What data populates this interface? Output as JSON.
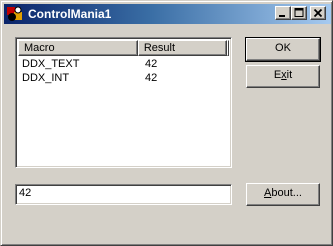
{
  "window": {
    "title": "ControlMania1",
    "icons": {
      "app": "app-icon",
      "minimize": "minimize-icon",
      "maximize": "maximize-icon",
      "close": "close-icon"
    }
  },
  "list": {
    "columns": [
      "Macro",
      "Result"
    ],
    "rows": [
      {
        "macro": "DDX_TEXT",
        "result": "42"
      },
      {
        "macro": "DDX_INT",
        "result": "42"
      }
    ]
  },
  "buttons": {
    "ok_label": "OK",
    "exit_prefix": "E",
    "exit_accel": "x",
    "exit_suffix": "it",
    "about_accel": "A",
    "about_suffix": "bout..."
  },
  "edit": {
    "value": "42"
  },
  "colors": {
    "face": "#d4d0c8",
    "title_start": "#0a246a",
    "title_end": "#a6caf0"
  }
}
